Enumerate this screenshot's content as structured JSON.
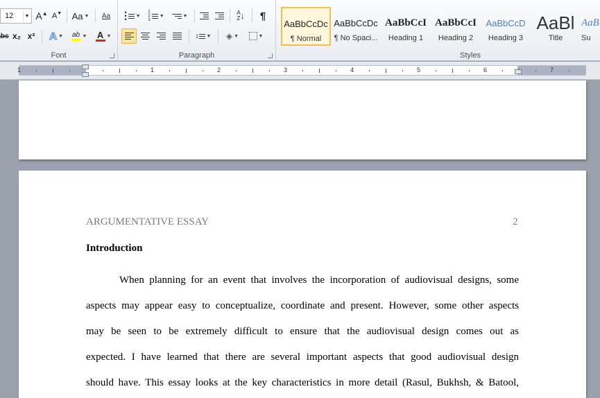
{
  "ribbon": {
    "font": {
      "group_label": "Font",
      "size_value": "12",
      "grow_label": "A",
      "shrink_label": "A",
      "change_case_label": "Aa",
      "subscript_label": "x₂",
      "superscript_label": "x²",
      "font_color_label": "A",
      "strike_label": "abc",
      "highlight_label": "ab"
    },
    "paragraph": {
      "group_label": "Paragraph",
      "pilcrow": "¶",
      "sort_top": "A",
      "sort_bottom": "Z"
    },
    "styles": {
      "group_label": "Styles",
      "items": [
        {
          "sample": "AaBbCcDc",
          "name": "¶ Normal"
        },
        {
          "sample": "AaBbCcDc",
          "name": "¶ No Spaci..."
        },
        {
          "sample": "AaBbCcI",
          "name": "Heading 1"
        },
        {
          "sample": "AaBbCcI",
          "name": "Heading 2"
        },
        {
          "sample": "AaBbCcD",
          "name": "Heading 3"
        },
        {
          "sample": "AaBl",
          "name": "Title"
        },
        {
          "sample": "AaB",
          "name": "Su"
        }
      ]
    }
  },
  "ruler": {
    "numbers": [
      "1",
      "1",
      "2",
      "3",
      "4",
      "5",
      "6",
      "7"
    ]
  },
  "document": {
    "running_head": "ARGUMENTATIVE ESSAY",
    "page_number": "2",
    "heading": "Introduction",
    "lines": [
      "When planning for an event that involves the incorporation of audiovisual designs, some",
      "aspects may appear easy to conceptualize, coordinate and present. However, some other aspects",
      "may be seen to be extremely difficult to ensure that the audiovisual design comes out as",
      "expected. I have learned that there are several important aspects that good audiovisual design",
      "should have. This essay looks at the key characteristics in more detail (Rasul, Bukhsh, & Batool,"
    ]
  }
}
